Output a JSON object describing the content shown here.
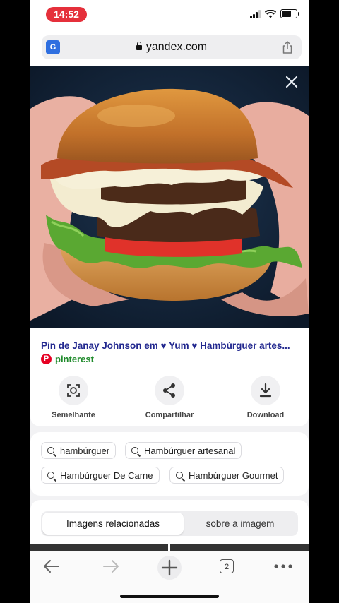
{
  "status_bar": {
    "time": "14:52",
    "time_pill_color": "#e5303b"
  },
  "browser": {
    "url": "yandex.com",
    "tab_count": "2"
  },
  "image": {
    "subject": "hamburger-photo",
    "info_title": "Pin de Janay Johnson em ♥ Yum ♥ Hambúrguer artes...",
    "source": "pinterest"
  },
  "actions": [
    {
      "label": "Semelhante",
      "icon": "visual-search-icon"
    },
    {
      "label": "Compartilhar",
      "icon": "share-icon"
    },
    {
      "label": "Download",
      "icon": "download-icon"
    }
  ],
  "tags": [
    "hambúrguer",
    "Hambúrguer artesanal",
    "Hambúrguer De Carne",
    "Hambúrguer Gourmet"
  ],
  "segmented": {
    "active": "Imagens relacionadas",
    "other": "sobre a imagem"
  },
  "colors": {
    "title": "#22288f",
    "source": "#1f8a2b",
    "pinterest": "#e60023"
  }
}
